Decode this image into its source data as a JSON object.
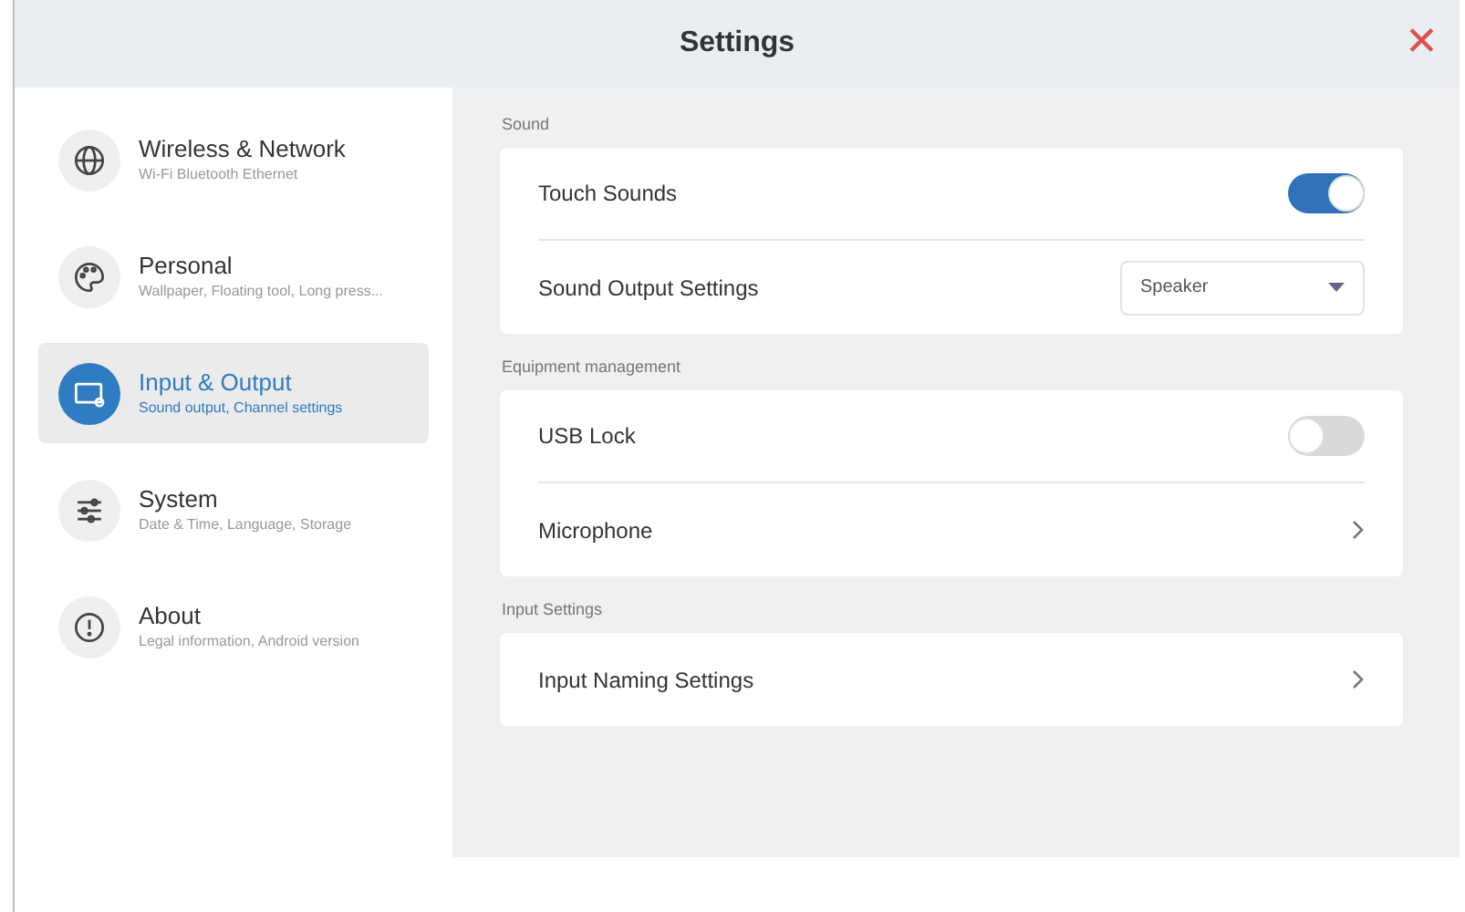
{
  "window": {
    "title": "Settings",
    "close_glyph": "✕"
  },
  "sidebar": {
    "items": [
      {
        "title": "Wireless & Network",
        "subtitle": "Wi-Fi Bluetooth Ethernet",
        "selected": false
      },
      {
        "title": "Personal",
        "subtitle": "Wallpaper, Floating tool, Long press...",
        "selected": false
      },
      {
        "title": "Input & Output",
        "subtitle": "Sound output, Channel settings",
        "selected": true
      },
      {
        "title": "System",
        "subtitle": "Date & Time, Language, Storage",
        "selected": false
      },
      {
        "title": "About",
        "subtitle": "Legal information, Android version",
        "selected": false
      }
    ]
  },
  "sections": [
    {
      "heading": "Sound",
      "rows": [
        {
          "kind": "toggle",
          "label": "Touch Sounds",
          "on": true
        },
        {
          "kind": "dropdown",
          "label": "Sound Output Settings",
          "value": "Speaker"
        }
      ]
    },
    {
      "heading": "Equipment management",
      "rows": [
        {
          "kind": "toggle",
          "label": "USB Lock",
          "on": false
        },
        {
          "kind": "link",
          "label": "Microphone"
        }
      ]
    },
    {
      "heading": "Input Settings",
      "rows": [
        {
          "kind": "link",
          "label": "Input Naming Settings"
        }
      ]
    }
  ]
}
